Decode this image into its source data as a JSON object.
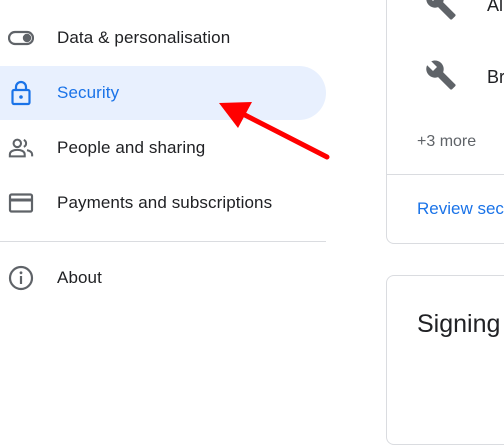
{
  "sidebar": {
    "items": [
      {
        "label": "Data & personalisation",
        "icon": "toggle-icon"
      },
      {
        "label": "Security",
        "icon": "lock-icon",
        "active": true
      },
      {
        "label": "People and sharing",
        "icon": "people-icon"
      },
      {
        "label": "Payments and subscriptions",
        "icon": "credit-card-icon"
      },
      {
        "label": "About",
        "icon": "info-icon"
      }
    ]
  },
  "third_party_card": {
    "apps": [
      {
        "name": "Al",
        "icon": "wrench-icon"
      },
      {
        "name": "Br",
        "icon": "wrench-icon"
      }
    ],
    "more_label": "+3 more",
    "review_link": "Review sec"
  },
  "signing_card": {
    "title": "Signing"
  },
  "colors": {
    "accent": "#1a73e8",
    "active_bg": "#e8f0fe",
    "annotation_arrow": "#ff0000",
    "border": "#dadce0"
  }
}
